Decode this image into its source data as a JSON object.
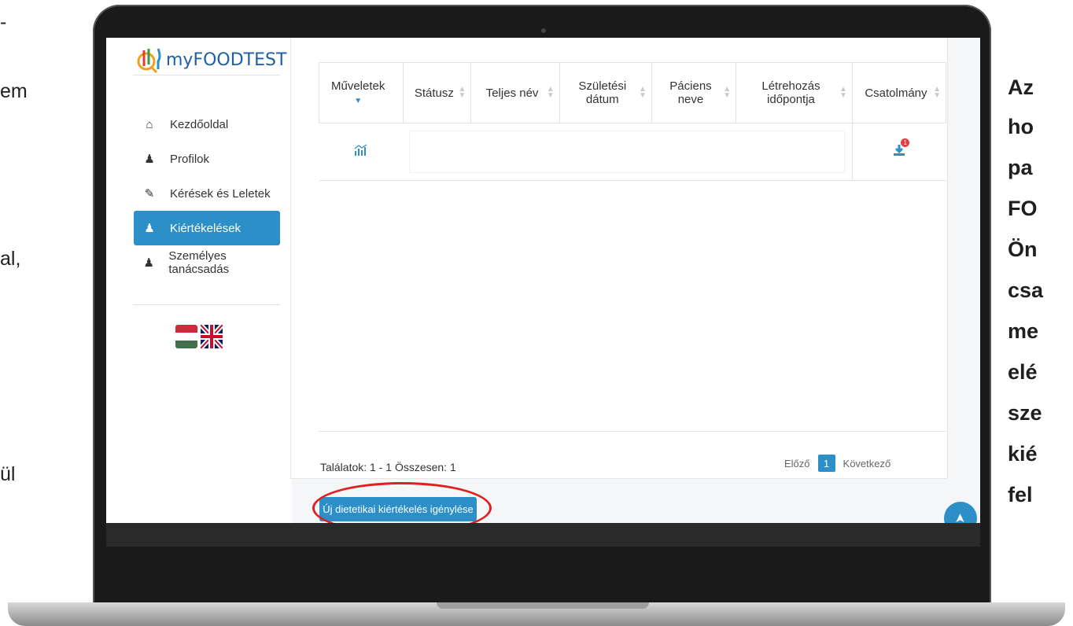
{
  "slide": {
    "left_fragments": [
      "-",
      "em",
      "al,",
      "ül"
    ],
    "right_fragments": [
      "Az",
      "ho",
      "pa",
      "FO",
      "Ön",
      "csa",
      "me",
      "elé",
      "sze",
      "kié",
      "fel"
    ]
  },
  "app": {
    "logo": {
      "prefix": "my",
      "name": "FOODTEST"
    },
    "sidebar": {
      "items": [
        {
          "label": "Kezdőoldal",
          "icon": "home-icon",
          "active": false
        },
        {
          "label": "Profilok",
          "icon": "user-icon",
          "active": false
        },
        {
          "label": "Kérések és Leletek",
          "icon": "pencil-icon",
          "active": false
        },
        {
          "label": "Kiértékelések",
          "icon": "users-icon",
          "active": true
        },
        {
          "label": "Személyes tanácsadás",
          "icon": "users-icon",
          "active": false
        }
      ],
      "languages": [
        "hungarian-flag",
        "uk-flag"
      ]
    },
    "table": {
      "headers": [
        "Műveletek",
        "Státusz",
        "Teljes név",
        "Születési dátum",
        "Páciens neve",
        "Létrehozás időpontja",
        "Csatolmány"
      ],
      "row": {
        "action_icon": "chart-icon",
        "attachment_icon": "download-icon",
        "attachment_badge": "1"
      }
    },
    "results_text": "Találatok: 1 - 1 Összesen: 1",
    "pagination": {
      "prev": "Előző",
      "page": "1",
      "next": "Következő"
    },
    "request_button": "Új dietetikai kiértékelés igénylése",
    "colors": {
      "accent": "#2d8fc7",
      "highlight": "#e02020"
    }
  }
}
